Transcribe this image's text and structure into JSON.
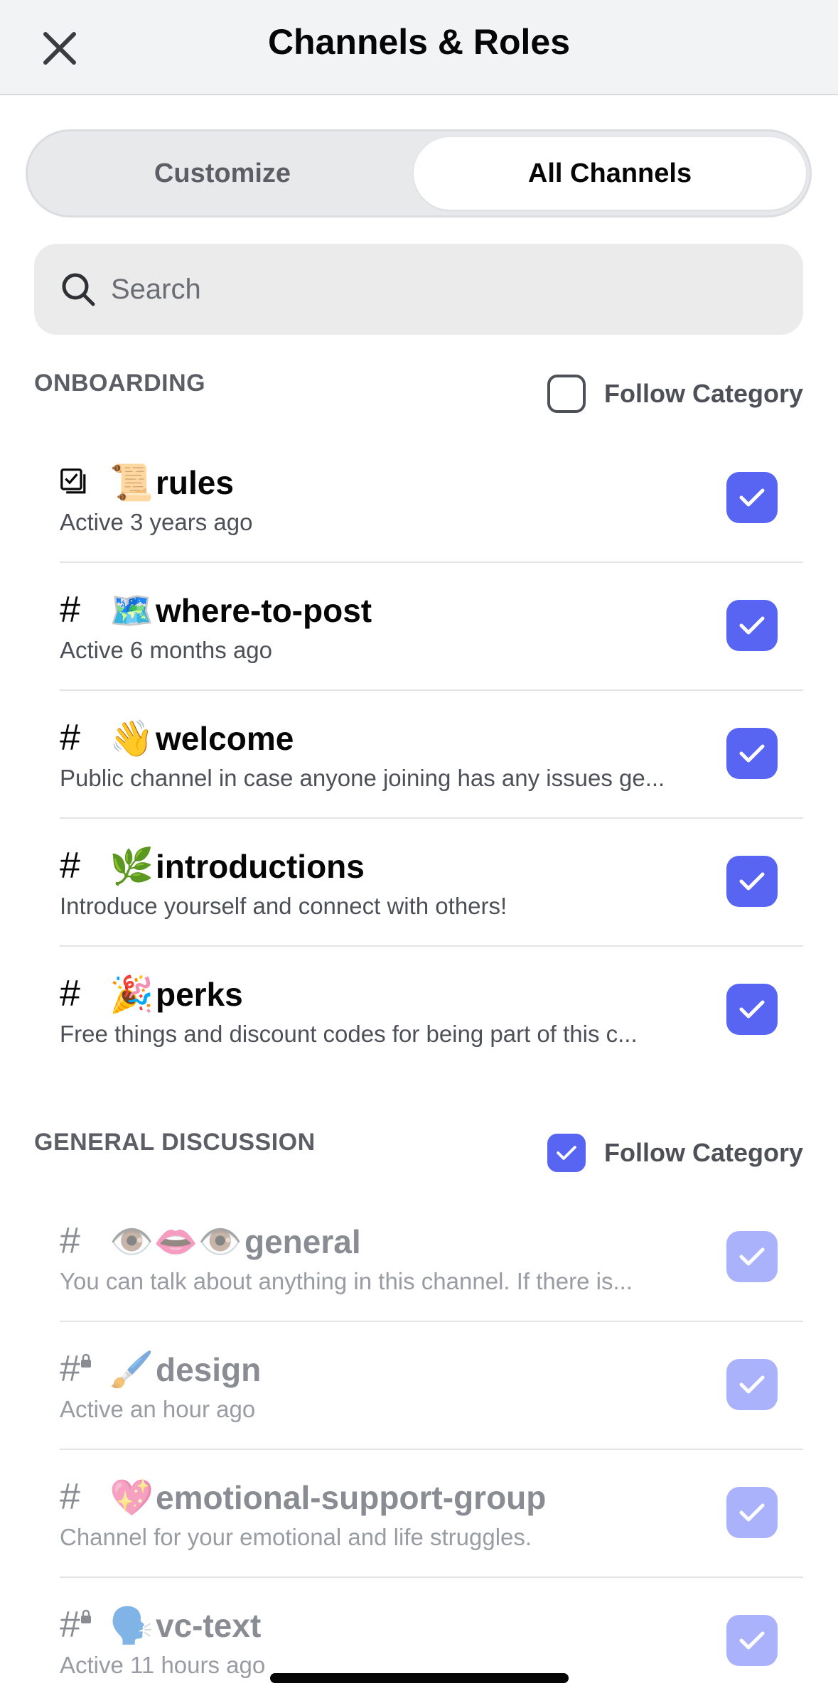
{
  "header": {
    "title": "Channels & Roles",
    "close_icon": "close-icon"
  },
  "tabs": [
    {
      "label": "Customize",
      "selected": false
    },
    {
      "label": "All Channels",
      "selected": true
    }
  ],
  "search": {
    "placeholder": "Search",
    "value": ""
  },
  "categories": [
    {
      "title": "ONBOARDING",
      "follow_label": "Follow Category",
      "follow_checked": false,
      "channels": [
        {
          "icon": "rules-channel-icon",
          "emoji": "📜",
          "name": "rules",
          "subtitle": "Active 3 years ago",
          "checked": true,
          "dimmed": false
        },
        {
          "icon": "#",
          "emoji": "🗺️",
          "name": "where-to-post",
          "subtitle": "Active 6 months ago",
          "checked": true,
          "dimmed": false
        },
        {
          "icon": "#",
          "emoji": "👋",
          "name": "welcome",
          "subtitle": "Public channel in case anyone joining has any issues ge...",
          "checked": true,
          "dimmed": false
        },
        {
          "icon": "#",
          "emoji": "🌿",
          "name": "introductions",
          "subtitle": "Introduce yourself and connect with others!",
          "checked": true,
          "dimmed": false
        },
        {
          "icon": "#",
          "emoji": "🎉",
          "name": "perks",
          "subtitle": "Free things and discount codes for being part of this c...",
          "checked": true,
          "dimmed": false
        }
      ]
    },
    {
      "title": "GENERAL DISCUSSION",
      "follow_label": "Follow Category",
      "follow_checked": true,
      "channels": [
        {
          "icon": "#",
          "emoji": "👁️👄👁️",
          "name": "general",
          "subtitle": "You can talk about anything in this channel. If there is...",
          "checked": true,
          "dimmed": true
        },
        {
          "icon": "#",
          "locked": true,
          "emoji": "🖌️",
          "name": "design",
          "subtitle": "Active an hour ago",
          "checked": true,
          "dimmed": true
        },
        {
          "icon": "#",
          "emoji": "💖",
          "name": "emotional-support-group",
          "subtitle": "Channel for your emotional and life struggles.",
          "checked": true,
          "dimmed": true
        },
        {
          "icon": "#",
          "locked": true,
          "emoji": "🗣️",
          "name": "vc-text",
          "subtitle": "Active 11 hours ago",
          "checked": true,
          "dimmed": true
        }
      ]
    }
  ],
  "colors": {
    "accent": "#5865f2",
    "accent_dim": "#aab2fb",
    "header_bg": "#f2f3f5"
  }
}
